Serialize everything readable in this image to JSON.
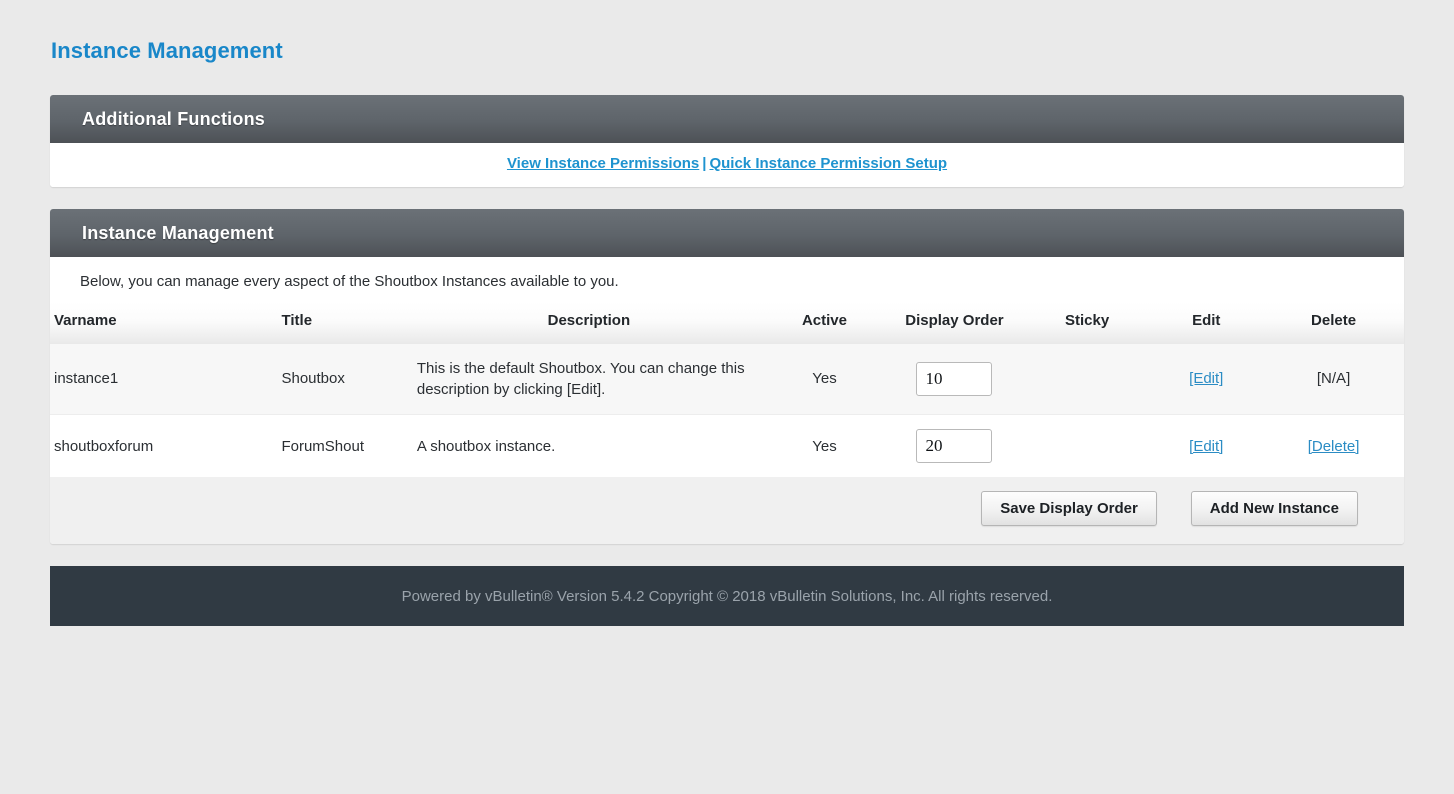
{
  "page": {
    "title": "Instance Management"
  },
  "additional_functions": {
    "header": "Additional Functions",
    "links": [
      {
        "label": "View Instance Permissions"
      },
      {
        "label": "Quick Instance Permission Setup"
      }
    ],
    "separator": "|"
  },
  "instance_management": {
    "header": "Instance Management",
    "intro": "Below, you can manage every aspect of the Shoutbox Instances available to you.",
    "columns": {
      "varname": "Varname",
      "title": "Title",
      "description": "Description",
      "active": "Active",
      "display_order": "Display Order",
      "sticky": "Sticky",
      "edit": "Edit",
      "delete": "Delete"
    },
    "rows": [
      {
        "varname": "instance1",
        "title": "Shoutbox",
        "description": "This is the default Shoutbox. You can change this description by clicking [Edit].",
        "active": "Yes",
        "display_order": "10",
        "sticky": "",
        "edit": "[Edit]",
        "delete": "[N/A]",
        "delete_is_link": false
      },
      {
        "varname": "shoutboxforum",
        "title": "ForumShout",
        "description": "A shoutbox instance.",
        "active": "Yes",
        "display_order": "20",
        "sticky": "",
        "edit": "[Edit]",
        "delete": "[Delete]",
        "delete_is_link": true
      }
    ],
    "buttons": {
      "save_display_order": "Save Display Order",
      "add_new_instance": "Add New Instance"
    }
  },
  "footer": {
    "text": "Powered by vBulletin® Version 5.4.2 Copyright © 2018 vBulletin Solutions, Inc. All rights reserved."
  },
  "colors": {
    "page_title": "#1987c9",
    "link": "#1e93cf",
    "table_link": "#2b8cc4",
    "panel_header_top": "#6b7177",
    "panel_header_bottom": "#4d5156",
    "footer_bg": "#303a43",
    "footer_text": "#9aa3ab",
    "page_bg": "#eaeaea"
  }
}
